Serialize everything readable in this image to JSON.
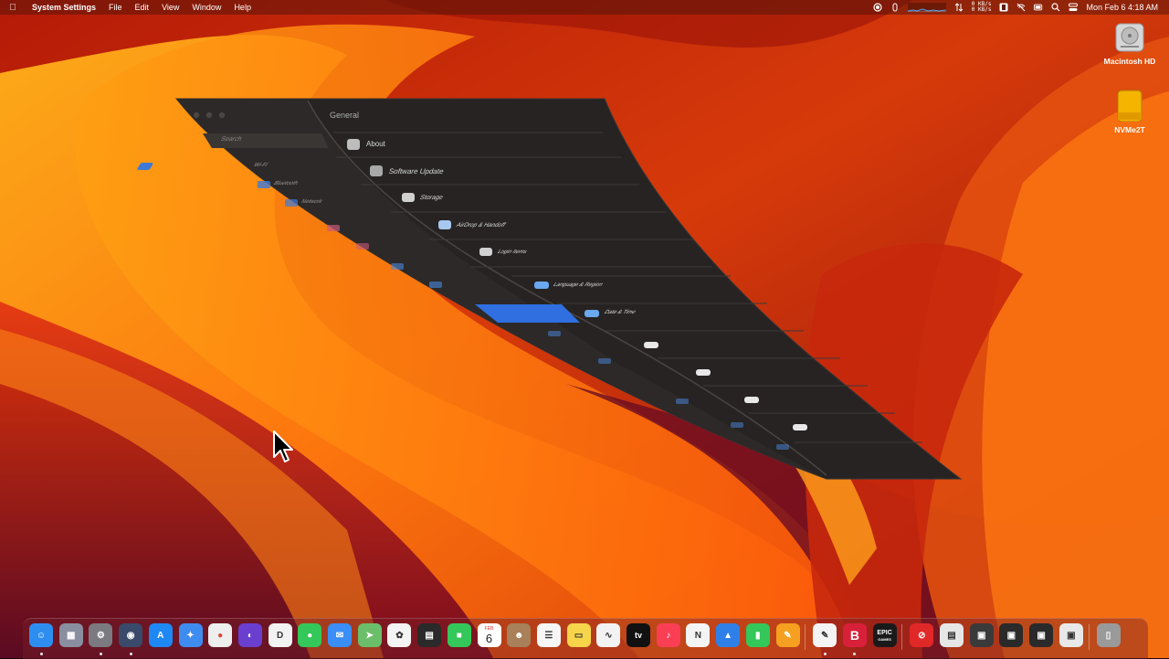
{
  "menubar": {
    "app_name": "System Settings",
    "menus": [
      "File",
      "Edit",
      "View",
      "Window",
      "Help"
    ],
    "net_upload": "0 KB/s",
    "net_download": "0 KB/s",
    "clock": "Mon Feb 6  4:18 AM"
  },
  "desktop": {
    "icons": [
      {
        "label": "Macintosh HD",
        "icon": "hard-drive-icon"
      },
      {
        "label": "NVMe2T",
        "icon": "external-drive-icon"
      }
    ]
  },
  "window": {
    "title": "General",
    "search_placeholder": "Search",
    "sidebar_items": [
      "Wi-Fi",
      "Bluetooth",
      "Network"
    ],
    "items": [
      "About",
      "Software Update",
      "Storage",
      "AirDrop & Handoff",
      "Login Items",
      "Language & Region",
      "Date & Time"
    ]
  },
  "dock": {
    "calendar_month": "FEB",
    "calendar_day": "6",
    "apps": [
      {
        "name": "Finder",
        "icon": "finder-icon",
        "color": "#2e8ef0",
        "running": true
      },
      {
        "name": "Launchpad",
        "icon": "launchpad-icon",
        "color": "#8a8fa0",
        "running": false
      },
      {
        "name": "System Settings",
        "icon": "gear-icon",
        "color": "#7a7a80",
        "running": true
      },
      {
        "name": "QuickTime Player",
        "icon": "quicktime-icon",
        "color": "#3a4a6a",
        "running": true
      },
      {
        "name": "App Store",
        "icon": "app-store-icon",
        "color": "#1e88f5",
        "running": false
      },
      {
        "name": "Safari",
        "icon": "safari-icon",
        "color": "#3f8cf0",
        "running": false
      },
      {
        "name": "Chrome",
        "icon": "chrome-icon",
        "color": "#eeeeee",
        "running": false
      },
      {
        "name": "Firefox",
        "icon": "firefox-icon",
        "color": "#6a3fd0",
        "running": false
      },
      {
        "name": "Dictionary",
        "icon": "dictionary-icon",
        "color": "#f2f2f2",
        "running": false
      },
      {
        "name": "Messages",
        "icon": "messages-icon",
        "color": "#34c759",
        "running": false
      },
      {
        "name": "Mail",
        "icon": "mail-icon",
        "color": "#3a8ef5",
        "running": false
      },
      {
        "name": "Maps",
        "icon": "maps-icon",
        "color": "#6bbf6b",
        "running": false
      },
      {
        "name": "Photos",
        "icon": "photos-icon",
        "color": "#f4f4f4",
        "running": false
      },
      {
        "name": "Final Cut Pro",
        "icon": "clapper-icon",
        "color": "#2a2a2a",
        "running": false
      },
      {
        "name": "FaceTime",
        "icon": "facetime-icon",
        "color": "#34c759",
        "running": false
      },
      {
        "name": "Calendar",
        "icon": "calendar-icon",
        "color": "#ffffff",
        "running": false
      },
      {
        "name": "Contacts",
        "icon": "contacts-icon",
        "color": "#a8805a",
        "running": false
      },
      {
        "name": "Reminders",
        "icon": "reminders-icon",
        "color": "#f6f6f6",
        "running": false
      },
      {
        "name": "Notes",
        "icon": "notes-icon",
        "color": "#f7d54a",
        "running": false
      },
      {
        "name": "Freeform",
        "icon": "freeform-icon",
        "color": "#f2f2f2",
        "running": false
      },
      {
        "name": "TV",
        "icon": "tv-icon",
        "color": "#111111",
        "running": false
      },
      {
        "name": "Music",
        "icon": "music-icon",
        "color": "#fa3f55",
        "running": false
      },
      {
        "name": "News",
        "icon": "news-icon",
        "color": "#f4f4f4",
        "running": false
      },
      {
        "name": "Keynote",
        "icon": "keynote-icon",
        "color": "#2f7fe8",
        "running": false
      },
      {
        "name": "Numbers",
        "icon": "numbers-icon",
        "color": "#34c759",
        "running": false
      },
      {
        "name": "Pages",
        "icon": "pages-icon",
        "color": "#f5a020",
        "running": false
      },
      {
        "name": "TextEdit",
        "icon": "textedit-icon",
        "color": "#f4f4f4",
        "running": true
      },
      {
        "name": "Bear",
        "icon": "b-app-icon",
        "color": "#d8203a",
        "running": true
      },
      {
        "name": "Epic Games",
        "icon": "epic-games-icon",
        "color": "#1a1a1a",
        "running": false
      },
      {
        "name": "Alarm",
        "icon": "alarm-icon",
        "color": "#e02828",
        "running": false
      },
      {
        "name": "Document",
        "icon": "document-icon",
        "color": "#e6e6e6",
        "running": false
      },
      {
        "name": "Screenshot 1",
        "icon": "screenshot-icon",
        "color": "#3a3a3a",
        "running": false
      },
      {
        "name": "Screenshot 2",
        "icon": "screenshot-icon",
        "color": "#2a2a2a",
        "running": false
      },
      {
        "name": "Screenshot 3",
        "icon": "screenshot-icon",
        "color": "#2a2a2a",
        "running": false
      },
      {
        "name": "Screenshot 4",
        "icon": "screenshot-icon",
        "color": "#e8e8e8",
        "running": false
      },
      {
        "name": "Trash",
        "icon": "trash-icon",
        "color": "#9a9a9a",
        "running": false
      }
    ],
    "labels": {
      "epic_top": "EPIC",
      "epic_bottom": "GAMES",
      "b_app": "B",
      "tv": "tv"
    }
  }
}
